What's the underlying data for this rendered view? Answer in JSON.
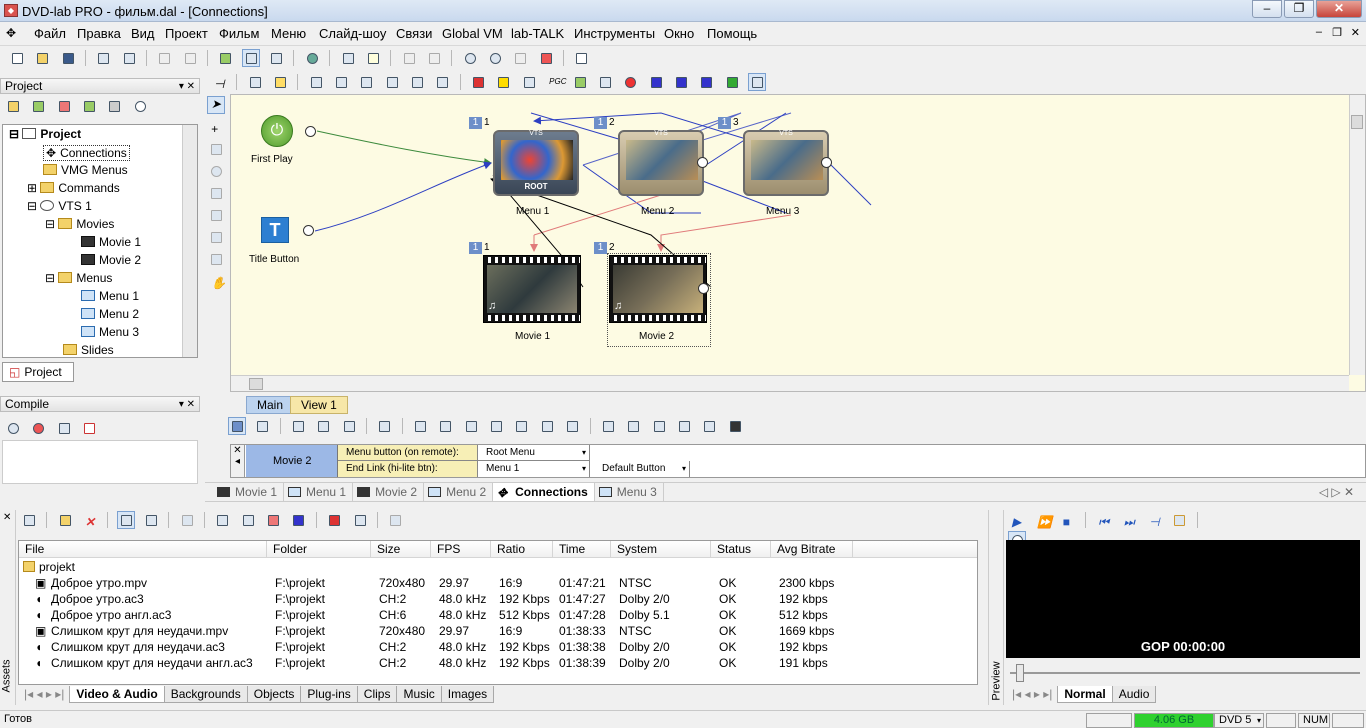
{
  "window": {
    "title": "DVD-lab PRO - фильм.dal - [Connections]",
    "controls": {
      "min": "–",
      "max": "❐",
      "close": "✕"
    }
  },
  "menubar": {
    "items": [
      "Файл",
      "Правка",
      "Вид",
      "Проект",
      "Фильм",
      "Меню",
      "Слайд-шоу",
      "Связи",
      "Global VM",
      "lab-TALK",
      "Инструменты",
      "Окно",
      "Помощь"
    ],
    "mdi": {
      "min": "–",
      "restore": "❐",
      "close": "✕"
    }
  },
  "project_panel": {
    "title": "Project",
    "tab_label": "Project",
    "tree": {
      "root": "Project",
      "connections": "Connections",
      "vmg_menus": "VMG Menus",
      "commands": "Commands",
      "vts": "VTS 1",
      "movies": "Movies",
      "movie1": "Movie 1",
      "movie2": "Movie 2",
      "menus": "Menus",
      "menu1": "Menu 1",
      "menu2": "Menu 2",
      "menu3": "Menu 3",
      "slides": "Slides"
    }
  },
  "compile_panel": {
    "title": "Compile"
  },
  "canvas": {
    "first_play": "First Play",
    "title_button": "Title Button",
    "menus": [
      {
        "badge": "1",
        "num": "1",
        "top_label": "VTS",
        "root_label": "ROOT",
        "label": "Menu 1"
      },
      {
        "badge": "1",
        "num": "2",
        "top_label": "VTS",
        "label": "Menu 2"
      },
      {
        "badge": "1",
        "num": "3",
        "top_label": "VTS",
        "label": "Menu 3"
      }
    ],
    "movies": [
      {
        "badge": "1",
        "num": "1",
        "label": "Movie 1"
      },
      {
        "badge": "1",
        "num": "2",
        "label": "Movie 2"
      }
    ],
    "view_tabs": {
      "main": "Main",
      "view1": "View 1"
    }
  },
  "props": {
    "selected": "Movie 2",
    "row1_label": "Menu button (on remote):",
    "row1_value": "Root Menu",
    "row2_label": "End Link (hi-lite btn):",
    "row2_value": "Menu 1",
    "row2_extra": "Default Button"
  },
  "doc_tabs": [
    "Movie 1",
    "Menu 1",
    "Movie 2",
    "Menu 2",
    "Connections",
    "Menu 3"
  ],
  "assets": {
    "side_label": "Assets",
    "columns": [
      "File",
      "Folder",
      "Size",
      "FPS",
      "Ratio",
      "Time",
      "System",
      "Status",
      "Avg Bitrate"
    ],
    "folder": "projekt",
    "rows": [
      [
        "Доброе утро.mpv",
        "F:\\projekt",
        "720x480",
        "29.97",
        "16:9",
        "01:47:21",
        "NTSC",
        "OK",
        "2300 kbps"
      ],
      [
        "Доброе утро.ac3",
        "F:\\projekt",
        "CH:2",
        "48.0 kHz",
        "192 Kbps",
        "01:47:27",
        "Dolby 2/0",
        "OK",
        "192 kbps"
      ],
      [
        "Доброе утро англ.ac3",
        "F:\\projekt",
        "CH:6",
        "48.0 kHz",
        "512 Kbps",
        "01:47:28",
        "Dolby 5.1",
        "OK",
        "512 kbps"
      ],
      [
        "Слишком крут для неудачи.mpv",
        "F:\\projekt",
        "720x480",
        "29.97",
        "16:9",
        "01:38:33",
        "NTSC",
        "OK",
        "1669 kbps"
      ],
      [
        "Слишком крут для неудачи.ac3",
        "F:\\projekt",
        "CH:2",
        "48.0 kHz",
        "192 Kbps",
        "01:38:38",
        "Dolby 2/0",
        "OK",
        "192 kbps"
      ],
      [
        "Слишком крут для неудачи англ.ac3",
        "F:\\projekt",
        "CH:2",
        "48.0 kHz",
        "192 Kbps",
        "01:38:39",
        "Dolby 2/0",
        "OK",
        "191 kbps"
      ]
    ],
    "tabs": [
      "Video & Audio",
      "Backgrounds",
      "Objects",
      "Plug-ins",
      "Clips",
      "Music",
      "Images"
    ]
  },
  "preview": {
    "side_label": "Preview",
    "gop": "GOP 00:00:00",
    "tabs": [
      "Normal",
      "Audio"
    ]
  },
  "statusbar": {
    "ready": "Готов",
    "disk": "4.06 GB",
    "disc_type": "DVD 5",
    "num": "NUM"
  }
}
